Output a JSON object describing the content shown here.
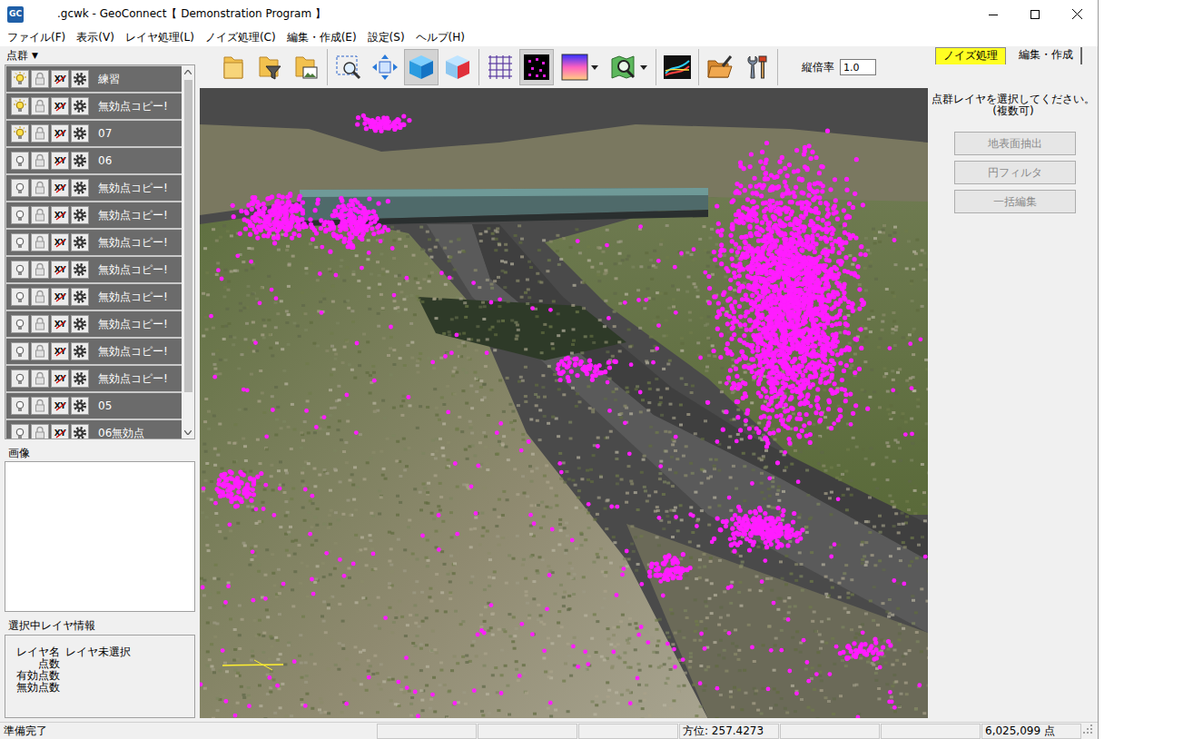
{
  "window": {
    "title": ".gcwk - GeoConnect【 Demonstration Program 】",
    "app_icon": "GC"
  },
  "menu": [
    "ファイル(F)",
    "表示(V)",
    "レイヤ処理(L)",
    "ノイズ処理(C)",
    "編集・作成(E)",
    "設定(S)",
    "ヘルプ(H)"
  ],
  "layer_panel": {
    "title": "点群",
    "dropdown": "▼",
    "coord_icon": "XY",
    "layers": [
      {
        "name": "練習",
        "visible": true
      },
      {
        "name": "無効点コピー!",
        "visible": true
      },
      {
        "name": "07",
        "visible": true
      },
      {
        "name": "06",
        "visible": false
      },
      {
        "name": "無効点コピー!",
        "visible": false
      },
      {
        "name": "無効点コピー!",
        "visible": false
      },
      {
        "name": "無効点コピー!",
        "visible": false
      },
      {
        "name": "無効点コピー!",
        "visible": false
      },
      {
        "name": "無効点コピー!",
        "visible": false
      },
      {
        "name": "無効点コピー!",
        "visible": false
      },
      {
        "name": "無効点コピー!",
        "visible": false
      },
      {
        "name": "無効点コピー!",
        "visible": false
      },
      {
        "name": "05",
        "visible": false
      },
      {
        "name": "06無効点",
        "visible": false
      }
    ]
  },
  "image_panel": {
    "title": "画像"
  },
  "info_panel": {
    "title": "選択中レイヤ情報",
    "rows": [
      {
        "label": "レイヤ名",
        "value": "レイヤ未選択"
      },
      {
        "label": "点数"
      },
      {
        "label": "有効点数"
      },
      {
        "label": "無効点数"
      }
    ]
  },
  "toolbar": {
    "scale_label": "縦倍率",
    "scale_value": "1.0",
    "buttons": [
      {
        "selected": false,
        "dropdown": false
      },
      {
        "selected": false,
        "dropdown": false
      },
      {
        "selected": false,
        "dropdown": false
      },
      {
        "selected": false,
        "dropdown": false
      },
      {
        "selected": false,
        "dropdown": false
      },
      {
        "selected": true,
        "dropdown": false
      },
      {
        "selected": false,
        "dropdown": false
      },
      {
        "selected": false,
        "dropdown": false
      },
      {
        "selected": true,
        "dropdown": false
      },
      {
        "selected": false,
        "dropdown": true
      },
      {
        "selected": false,
        "dropdown": true
      },
      {
        "selected": false,
        "dropdown": false
      },
      {
        "selected": false,
        "dropdown": false
      },
      {
        "selected": false,
        "dropdown": false
      }
    ]
  },
  "right_panel": {
    "tabs": [
      {
        "label": "ノイズ処理",
        "selected": true
      },
      {
        "label": "編集・作成",
        "selected": false
      }
    ],
    "message_lines": [
      "点群レイヤを選択してください。",
      "(複数可)"
    ],
    "buttons": [
      {
        "label": "地表面抽出",
        "disabled": true
      },
      {
        "label": "円フィルタ",
        "disabled": true
      },
      {
        "label": "一括編集",
        "disabled": true
      }
    ]
  },
  "status_bar": {
    "message": "準備完了",
    "fields": [
      "",
      "",
      "",
      "方位: 257.4273",
      "",
      "",
      "6,025,099 点"
    ]
  }
}
